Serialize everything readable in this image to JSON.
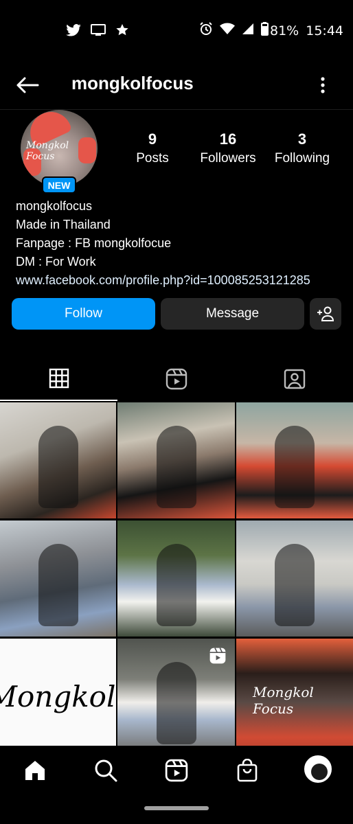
{
  "status_bar": {
    "battery": "81%",
    "time": "15:44",
    "left_icons": [
      "twitter-icon",
      "cast-icon",
      "star-icon"
    ],
    "right_icons": [
      "alarm-icon",
      "wifi-icon",
      "signal-icon",
      "battery-icon"
    ]
  },
  "header": {
    "title": "mongkolfocus"
  },
  "profile": {
    "avatar_watermark": "Mongkol Focus",
    "badge": "NEW",
    "stats": [
      {
        "value": "9",
        "label": "Posts"
      },
      {
        "value": "16",
        "label": "Followers"
      },
      {
        "value": "3",
        "label": "Following"
      }
    ],
    "bio": {
      "name": "mongkolfocus",
      "line1": "Made in Thailand",
      "line2": "Fanpage : FB mongkolfocue",
      "line3": "DM : For Work",
      "link": "www.facebook.com/profile.php?id=100085253121285"
    }
  },
  "actions": {
    "follow_label": "Follow",
    "message_label": "Message"
  },
  "tabs": [
    "grid-icon",
    "reels-icon",
    "tagged-icon"
  ],
  "grid": {
    "logo_text": "Mongkol Focu",
    "watermark": "Mongkol Focus"
  },
  "bottom_nav": [
    "home-icon",
    "search-icon",
    "reels-icon",
    "shop-icon",
    "profile-avatar"
  ],
  "colors": {
    "accent": "#0095f6",
    "button_secondary": "#262626",
    "background": "#000000"
  }
}
